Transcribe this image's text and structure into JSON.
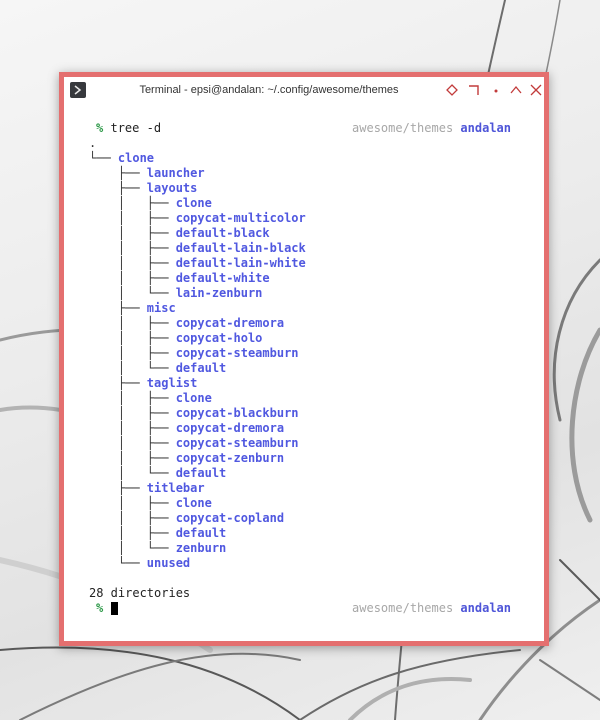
{
  "window": {
    "title": "Terminal - epsi@andalan: ~/.config/awesome/themes",
    "frame_color": "#e46f6f"
  },
  "titlebar_buttons": [
    {
      "name": "sticky-icon",
      "label": "sticky"
    },
    {
      "name": "maximize-corner-icon",
      "label": "maximize"
    },
    {
      "name": "minimize-dot-icon",
      "label": "minimize"
    },
    {
      "name": "shade-up-icon",
      "label": "shade"
    },
    {
      "name": "close-icon",
      "label": "close"
    }
  ],
  "terminal": {
    "prompt_symbol": "%",
    "command": "tree -d",
    "right_prompt": {
      "path": "awesome/themes",
      "host": "andalan"
    },
    "tree": [
      {
        "prefix": ".",
        "name": ""
      },
      {
        "prefix": "└── ",
        "name": "clone"
      },
      {
        "prefix": "    ├── ",
        "name": "launcher"
      },
      {
        "prefix": "    ├── ",
        "name": "layouts"
      },
      {
        "prefix": "    │   ├── ",
        "name": "clone"
      },
      {
        "prefix": "    │   ├── ",
        "name": "copycat-multicolor"
      },
      {
        "prefix": "    │   ├── ",
        "name": "default-black"
      },
      {
        "prefix": "    │   ├── ",
        "name": "default-lain-black"
      },
      {
        "prefix": "    │   ├── ",
        "name": "default-lain-white"
      },
      {
        "prefix": "    │   ├── ",
        "name": "default-white"
      },
      {
        "prefix": "    │   └── ",
        "name": "lain-zenburn"
      },
      {
        "prefix": "    ├── ",
        "name": "misc"
      },
      {
        "prefix": "    │   ├── ",
        "name": "copycat-dremora"
      },
      {
        "prefix": "    │   ├── ",
        "name": "copycat-holo"
      },
      {
        "prefix": "    │   ├── ",
        "name": "copycat-steamburn"
      },
      {
        "prefix": "    │   └── ",
        "name": "default"
      },
      {
        "prefix": "    ├── ",
        "name": "taglist"
      },
      {
        "prefix": "    │   ├── ",
        "name": "clone"
      },
      {
        "prefix": "    │   ├── ",
        "name": "copycat-blackburn"
      },
      {
        "prefix": "    │   ├── ",
        "name": "copycat-dremora"
      },
      {
        "prefix": "    │   ├── ",
        "name": "copycat-steamburn"
      },
      {
        "prefix": "    │   ├── ",
        "name": "copycat-zenburn"
      },
      {
        "prefix": "    │   └── ",
        "name": "default"
      },
      {
        "prefix": "    ├── ",
        "name": "titlebar"
      },
      {
        "prefix": "    │   ├── ",
        "name": "clone"
      },
      {
        "prefix": "    │   ├── ",
        "name": "copycat-copland"
      },
      {
        "prefix": "    │   ├── ",
        "name": "default"
      },
      {
        "prefix": "    │   └── ",
        "name": "zenburn"
      },
      {
        "prefix": "    └── ",
        "name": "unused"
      }
    ],
    "summary": "28 directories"
  },
  "colors": {
    "prompt": "#2f9a4a",
    "directory": "#5058e0",
    "right_path": "#a7a7a7",
    "right_host": "#4e55d8"
  }
}
